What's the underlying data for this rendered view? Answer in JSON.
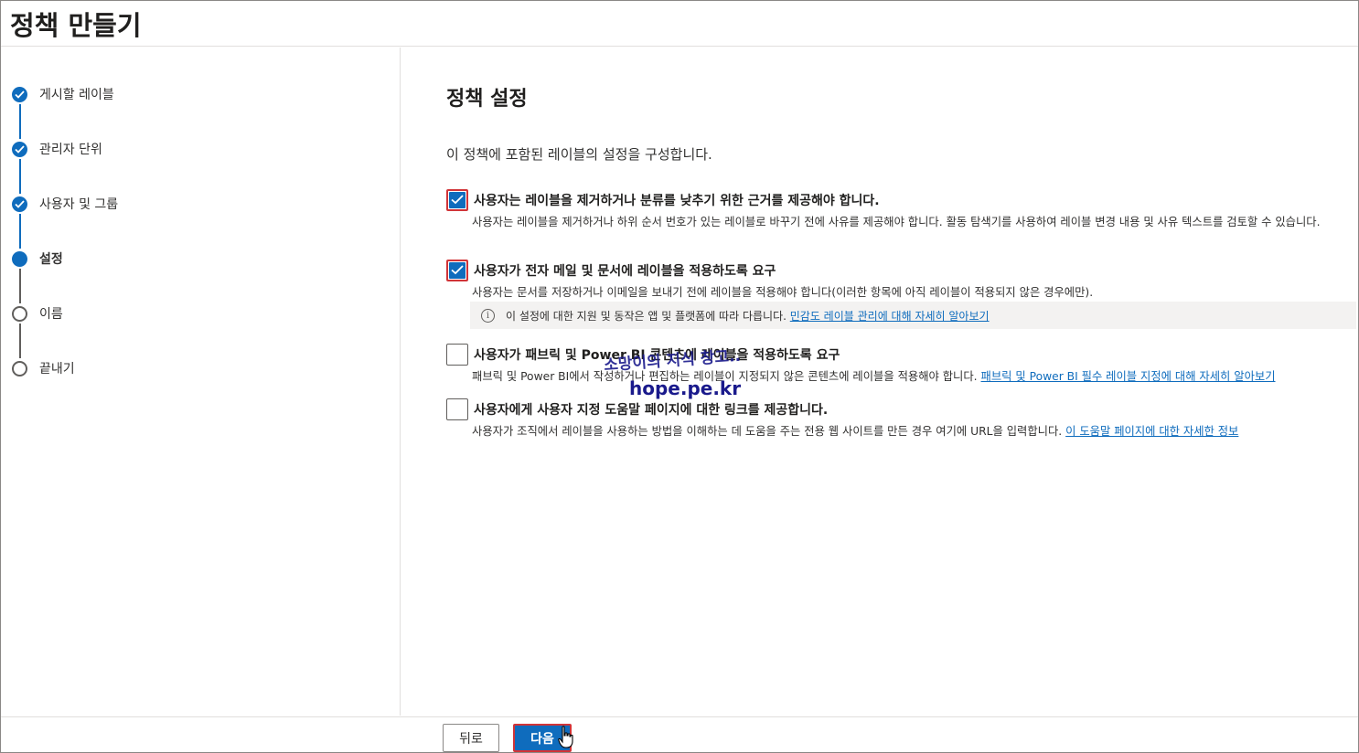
{
  "header": {
    "title": "정책 만들기"
  },
  "steps": [
    {
      "label": "게시할 레이블",
      "state": "done"
    },
    {
      "label": "관리자 단위",
      "state": "done"
    },
    {
      "label": "사용자 및 그룹",
      "state": "done"
    },
    {
      "label": "설정",
      "state": "current"
    },
    {
      "label": "이름",
      "state": "todo"
    },
    {
      "label": "끝내기",
      "state": "todo"
    }
  ],
  "main": {
    "title": "정책 설정",
    "intro": "이 정책에 포함된 레이블의 설정을 구성합니다.",
    "options": [
      {
        "title": "사용자는 레이블을 제거하거나 분류를 낮추기 위한 근거를 제공해야 합니다.",
        "desc": "사용자는 레이블을 제거하거나 하위 순서 번호가 있는 레이블로 바꾸기 전에 사유를 제공해야 합니다. 활동 탐색기를 사용하여 레이블 변경 내용 및 사유 텍스트를 검토할 수 있습니다.",
        "checked": true
      },
      {
        "title": "사용자가 전자 메일 및 문서에 레이블을 적용하도록 요구",
        "desc": "사용자는 문서를 저장하거나 이메일을 보내기 전에 레이블을 적용해야 합니다(이러한 항목에 아직 레이블이 적용되지 않은 경우에만).",
        "checked": true
      },
      {
        "title": "사용자가 패브릭 및 Power BI 콘텐츠에 레이블을 적용하도록 요구",
        "desc": "패브릭 및 Power BI에서 작성하거나 편집하는 레이블이 지정되지 않은 콘텐츠에 레이블을 적용해야 합니다.",
        "link": "패브릭 및 Power BI 필수 레이블 지정에 대해 자세히 알아보기",
        "checked": false
      },
      {
        "title": "사용자에게 사용자 지정 도움말 페이지에 대한 링크를 제공합니다.",
        "desc": "사용자가 조직에서 레이블을 사용하는 방법을 이해하는 데 도움을 주는 전용 웹 사이트를 만든 경우 여기에 URL을 입력합니다.",
        "link": "이 도움말 페이지에 대한 자세한 정보",
        "checked": false
      }
    ],
    "info": {
      "text": "이 설정에 대한 지원 및 동작은 앱 및 플랫폼에 따라 다릅니다.",
      "link": "민감도 레이블 관리에 대해 자세히 알아보기"
    }
  },
  "watermark": {
    "line1": "소망이의 지식 창고..",
    "line2": "hope.pe.kr"
  },
  "footer": {
    "back_label": "뒤로",
    "next_label": "다음"
  },
  "colors": {
    "accent": "#0f6cbd",
    "highlight": "#d13438"
  },
  "icons": {
    "step_done": "check-icon",
    "info": "info-icon",
    "cursor": "hand-pointer-icon"
  }
}
